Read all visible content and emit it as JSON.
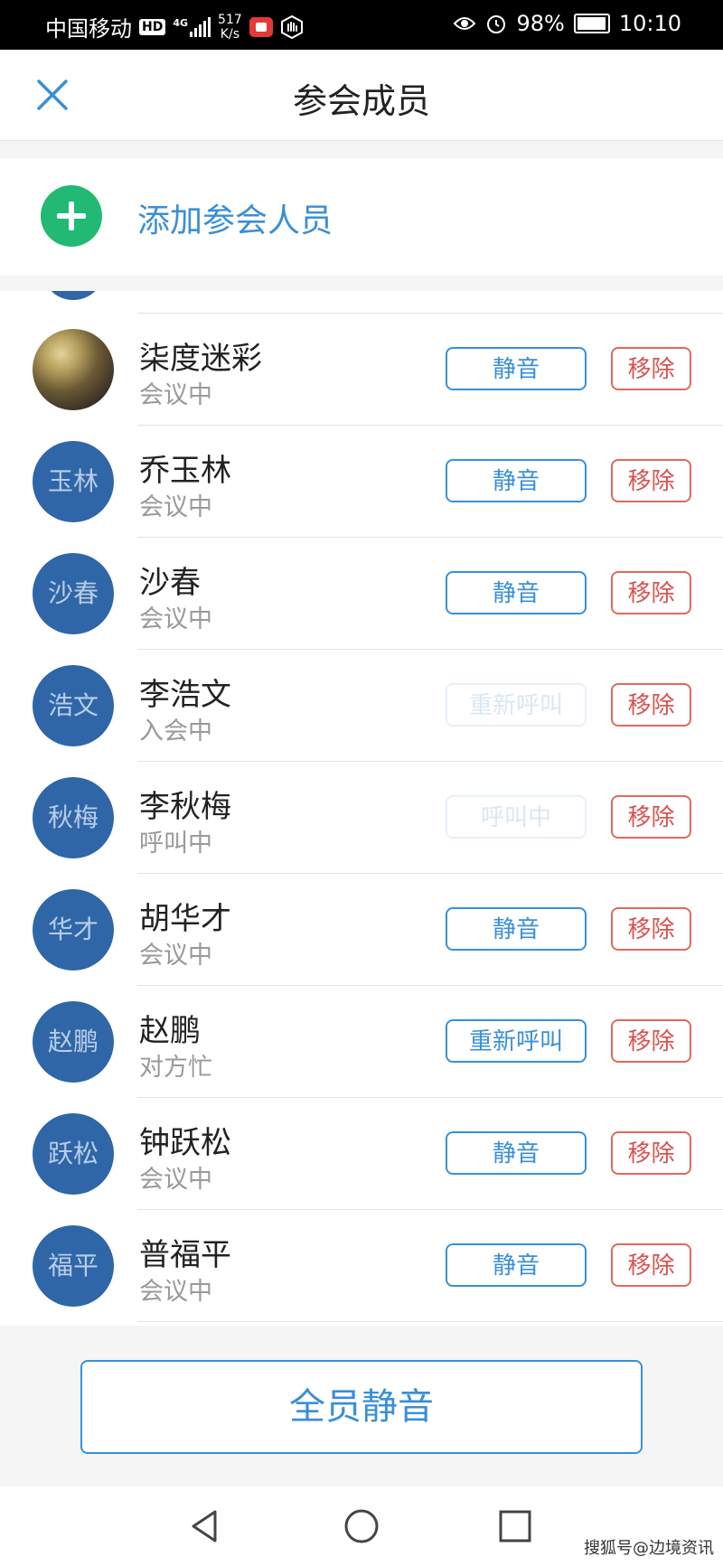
{
  "status_bar": {
    "carrier": "中国移动",
    "hd_badge": "HD",
    "network": "4G",
    "speed_value": "517",
    "speed_unit": "K/s",
    "battery": "98%",
    "battery_level": 0.98,
    "time": "10:10",
    "icons": [
      "hd-icon",
      "signal-icon",
      "screen-record-icon",
      "gesture-icon",
      "eye-comfort-icon",
      "alarm-icon",
      "battery-icon"
    ]
  },
  "header": {
    "title": "参会成员",
    "close_icon": "close-icon"
  },
  "add_member": {
    "label": "添加参会人员",
    "icon": "plus-icon"
  },
  "members": [
    {
      "name": "柒度迷彩",
      "avatar_text": "",
      "avatar_type": "photo",
      "status": "会议中",
      "action": "静音",
      "action_style": "active",
      "remove": "移除"
    },
    {
      "name": "乔玉林",
      "avatar_text": "玉林",
      "avatar_type": "text",
      "status": "会议中",
      "action": "静音",
      "action_style": "active",
      "remove": "移除"
    },
    {
      "name": "沙春",
      "avatar_text": "沙春",
      "avatar_type": "text",
      "status": "会议中",
      "action": "静音",
      "action_style": "active",
      "remove": "移除"
    },
    {
      "name": "李浩文",
      "avatar_text": "浩文",
      "avatar_type": "text",
      "status": "入会中",
      "action": "重新呼叫",
      "action_style": "disabled",
      "remove": "移除"
    },
    {
      "name": "李秋梅",
      "avatar_text": "秋梅",
      "avatar_type": "text",
      "status": "呼叫中",
      "action": "呼叫中",
      "action_style": "disabled",
      "remove": "移除"
    },
    {
      "name": "胡华才",
      "avatar_text": "华才",
      "avatar_type": "text",
      "status": "会议中",
      "action": "静音",
      "action_style": "active",
      "remove": "移除"
    },
    {
      "name": "赵鹏",
      "avatar_text": "赵鹏",
      "avatar_type": "text",
      "status": "对方忙",
      "action": "重新呼叫",
      "action_style": "active",
      "remove": "移除"
    },
    {
      "name": "钟跃松",
      "avatar_text": "跃松",
      "avatar_type": "text",
      "status": "会议中",
      "action": "静音",
      "action_style": "active",
      "remove": "移除"
    },
    {
      "name": "普福平",
      "avatar_text": "福平",
      "avatar_type": "text",
      "status": "会议中",
      "action": "静音",
      "action_style": "active",
      "remove": "移除"
    }
  ],
  "mute_all": {
    "label": "全员静音"
  },
  "nav_bar": {
    "icons": [
      "back-icon",
      "home-icon",
      "recent-apps-icon"
    ]
  },
  "watermark": "搜狐号@边境资讯",
  "colors": {
    "accent": "#3a8fd6",
    "danger": "#d9534f",
    "add": "#21b974",
    "avatar": "#2f66a8"
  }
}
